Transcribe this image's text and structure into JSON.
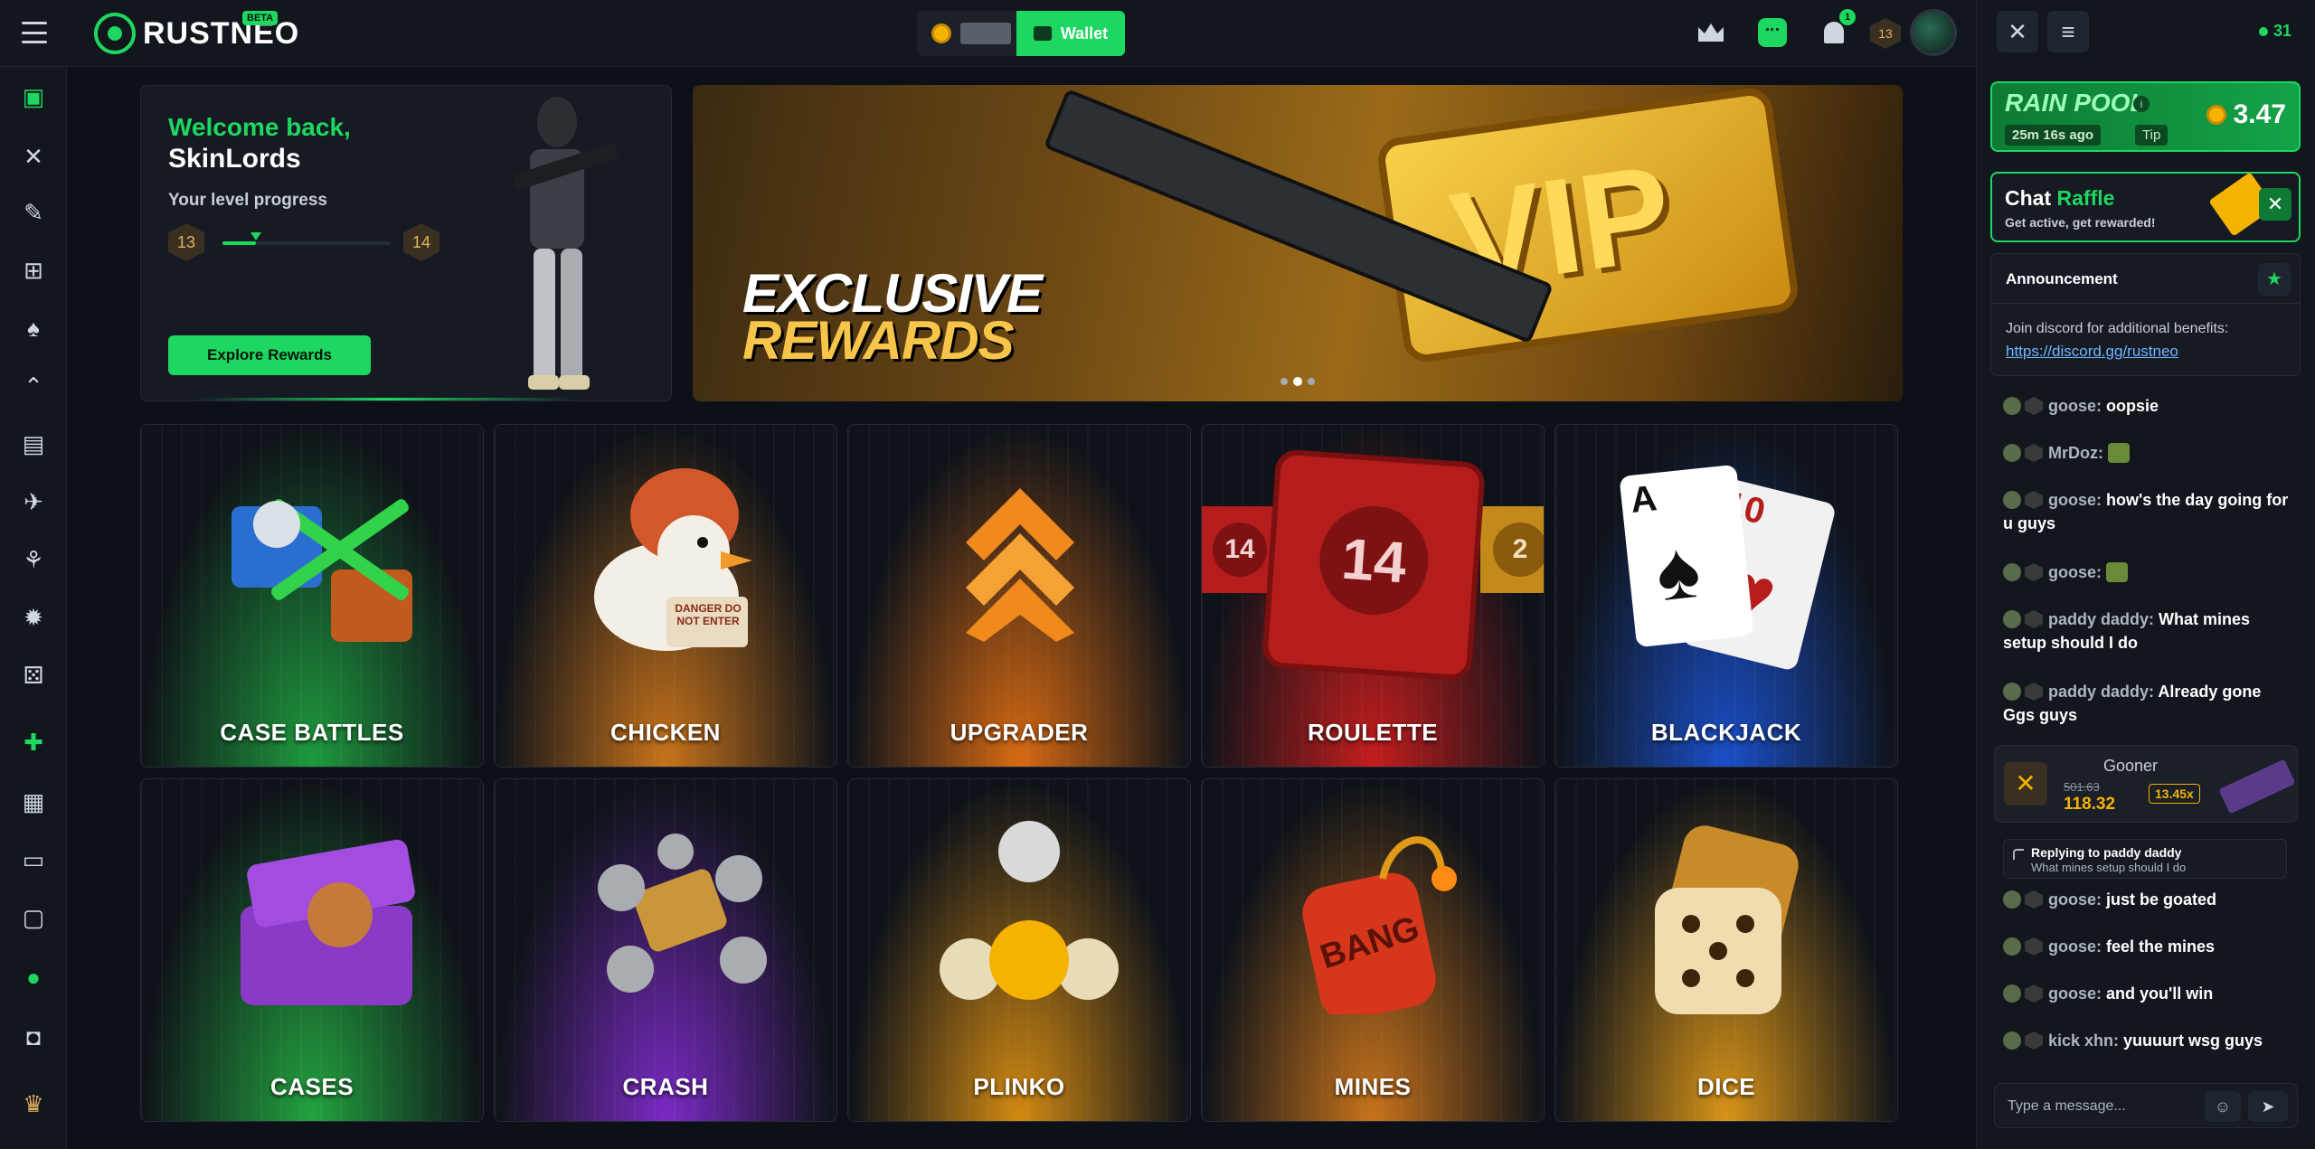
{
  "brand": {
    "name": "RUSTNEO",
    "badge": "BETA"
  },
  "topbar": {
    "wallet_label": "Wallet",
    "notifications_count": "1",
    "level": "13"
  },
  "welcome": {
    "greeting": "Welcome back,",
    "username": "SkinLords",
    "level_label": "Your level progress",
    "level_current": "13",
    "level_next": "14",
    "progress_fraction": 0.2,
    "button": "Explore Rewards"
  },
  "banner": {
    "line1": "EXCLUSIVE",
    "line2": "REWARDS",
    "plate_text": "VIP",
    "slides": 3,
    "active_slide": 1
  },
  "games": [
    {
      "label": "CASE BATTLES",
      "color": "#1e9b3e"
    },
    {
      "label": "CHICKEN",
      "color": "#c8731a"
    },
    {
      "label": "UPGRADER",
      "color": "#d86a12"
    },
    {
      "label": "ROULETTE",
      "color": "#c41d1d"
    },
    {
      "label": "BLACKJACK",
      "color": "#1a4fc8"
    },
    {
      "label": "CASES",
      "color": "#22a33f"
    },
    {
      "label": "CRASH",
      "color": "#7a2ac4"
    },
    {
      "label": "PLINKO",
      "color": "#d38a12"
    },
    {
      "label": "MINES",
      "color": "#c8731a"
    },
    {
      "label": "DICE",
      "color": "#d89418"
    }
  ],
  "tile_text": {
    "roulette_main": "14",
    "roulette_left": "14",
    "roulette_right": "2",
    "card_rank": "A",
    "card_rank2": "10",
    "mines_text": "BANG",
    "chicken_sign": "DANGER DO NOT ENTER"
  },
  "chat": {
    "online_count": "31",
    "rain": {
      "title": "RAIN POOL",
      "ago": "25m 16s ago",
      "tip": "Tip",
      "amount": "3.47"
    },
    "raffle": {
      "title_white": "Chat",
      "title_green": "Raffle",
      "subtitle": "Get active, get rewarded!"
    },
    "announcement": {
      "title": "Announcement",
      "text": "Join discord for additional benefits:",
      "link": "https://discord.gg/rustneo"
    },
    "messages": [
      {
        "user": "goose",
        "text": "oopsie"
      },
      {
        "user": "MrDoz",
        "text": ""
      },
      {
        "user": "goose",
        "text": "how's the day going for u guys"
      },
      {
        "user": "goose",
        "text": ""
      },
      {
        "user": "paddy daddy",
        "text": "What mines setup should I do"
      },
      {
        "user": "paddy daddy",
        "text": "Already gone Ggs guys"
      }
    ],
    "drop": {
      "user": "Gooner",
      "old_value": "501.63",
      "value": "118.32",
      "multiplier": "13.45x"
    },
    "reply": {
      "title": "Replying to paddy daddy",
      "quote": "What mines setup should I do"
    },
    "messages2": [
      {
        "user": "goose",
        "text": "just be goated"
      },
      {
        "user": "goose",
        "text": "feel the mines"
      },
      {
        "user": "goose",
        "text": "and you'll win"
      },
      {
        "user": "kick xhn",
        "text": "yuuuurt wsg guys"
      }
    ],
    "input_placeholder": "Type a message..."
  }
}
